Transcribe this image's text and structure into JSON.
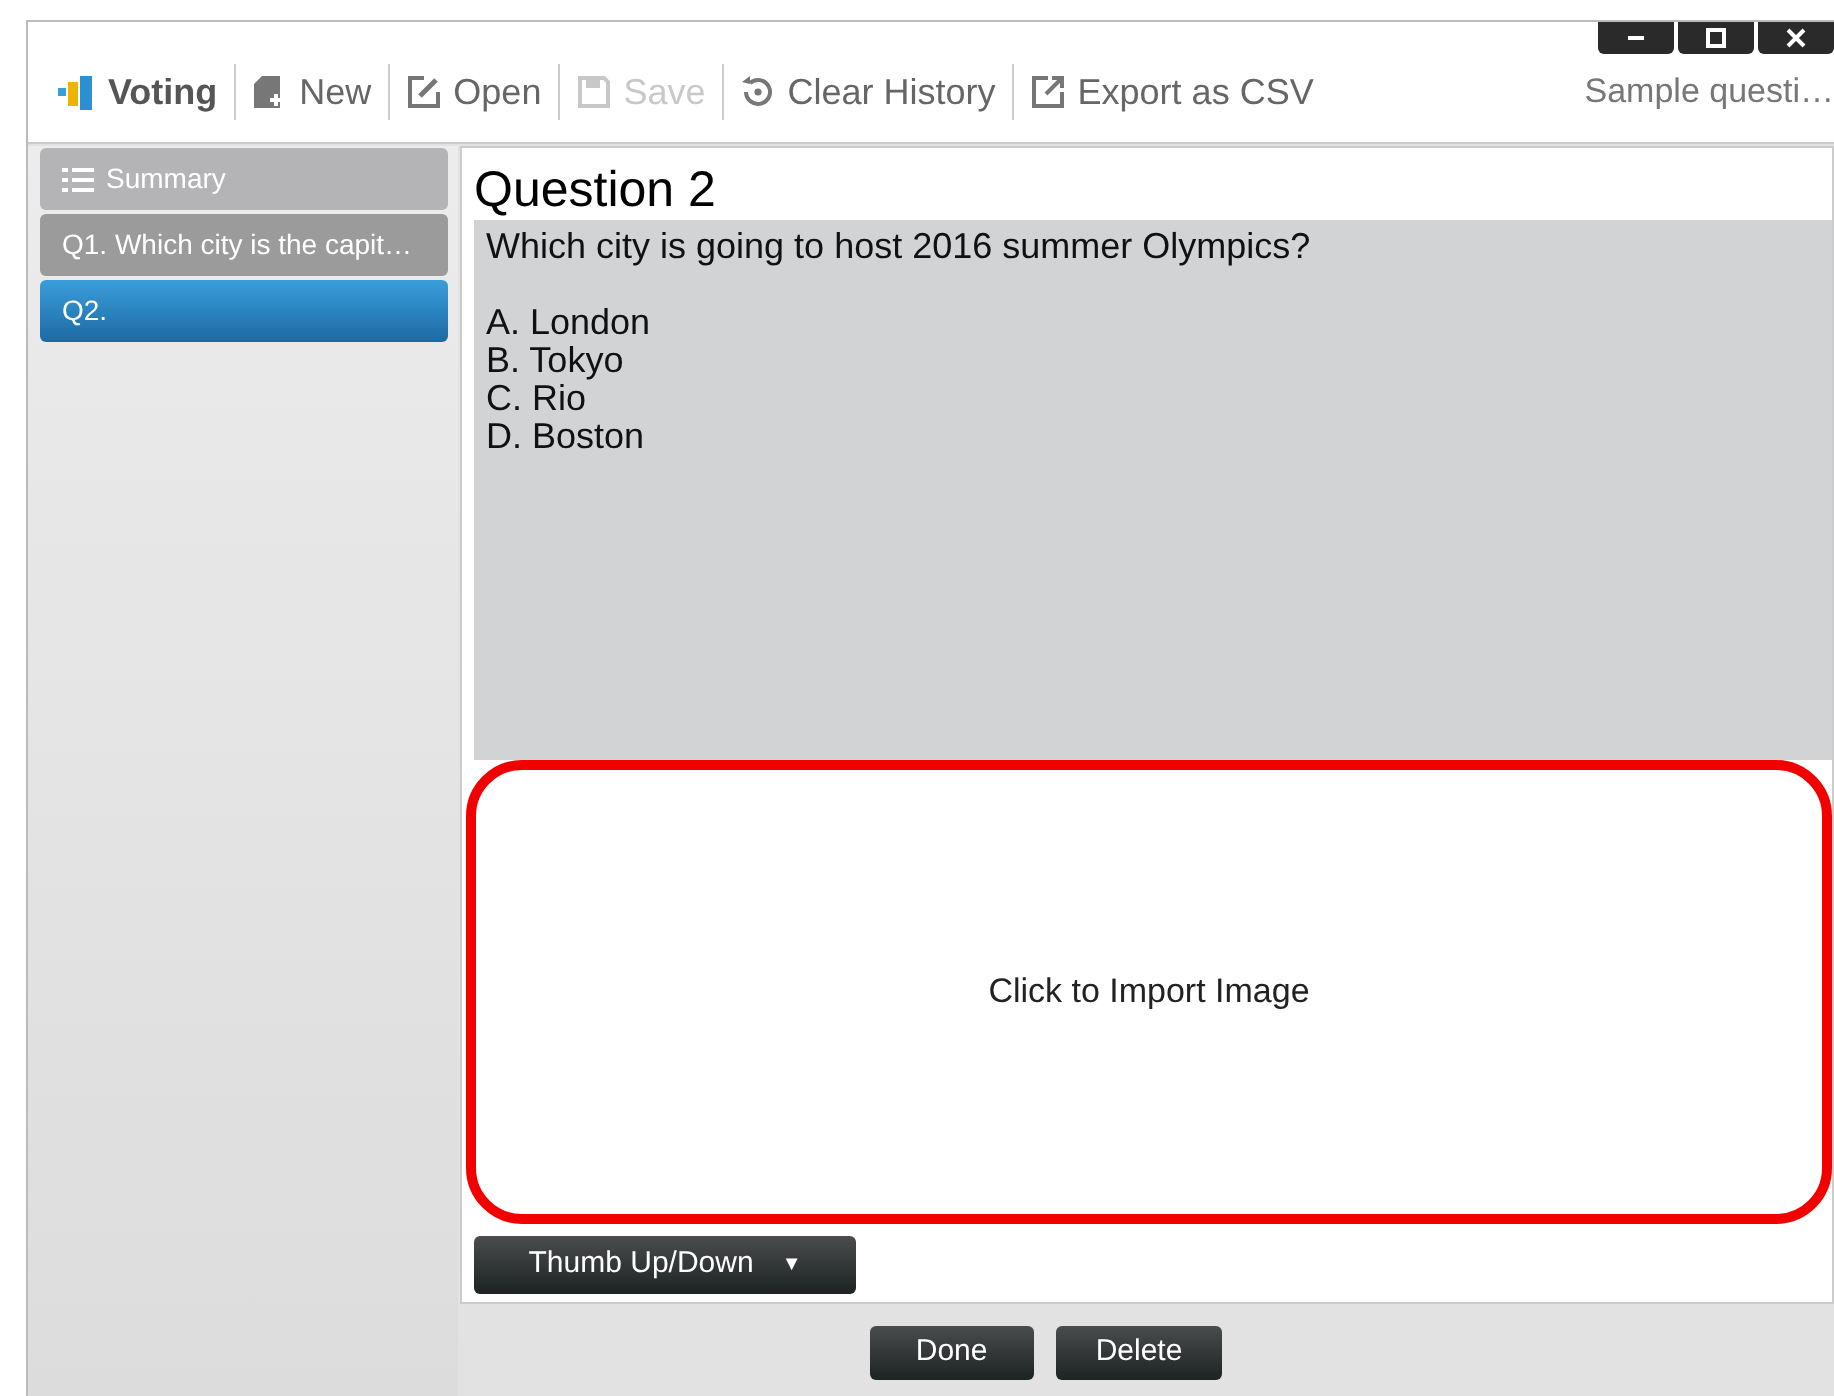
{
  "window": {
    "title": "Sample questi…",
    "controls": [
      {
        "kind": "minimize"
      },
      {
        "kind": "maximize"
      },
      {
        "kind": "close"
      }
    ]
  },
  "app": {
    "label": "Voting"
  },
  "toolbar": [
    {
      "kind": "new",
      "label": "New",
      "disabled": false
    },
    {
      "kind": "open",
      "label": "Open",
      "disabled": false
    },
    {
      "kind": "save",
      "label": "Save",
      "disabled": true
    },
    {
      "kind": "history",
      "label": "Clear History",
      "disabled": false
    },
    {
      "kind": "export",
      "label": "Export as CSV",
      "disabled": false
    }
  ],
  "sidebar": {
    "items": [
      {
        "kind": "summary",
        "label": "Summary",
        "selected": false
      },
      {
        "kind": "question",
        "label": "Q1. Which city is the capit…",
        "selected": false
      },
      {
        "kind": "question",
        "label": "Q2.",
        "selected": true
      }
    ]
  },
  "question": {
    "title": "Question 2",
    "prompt": "Which city is going to host 2016 summer Olympics?",
    "options": [
      "A. London",
      "B. Tokyo",
      "C. Rio",
      "D. Boston"
    ],
    "image_area": "Click to Import Image",
    "type_dropdown": "Thumb Up/Down",
    "dropdown_arrow": "▼"
  },
  "buttons": [
    "Done",
    "Delete"
  ]
}
